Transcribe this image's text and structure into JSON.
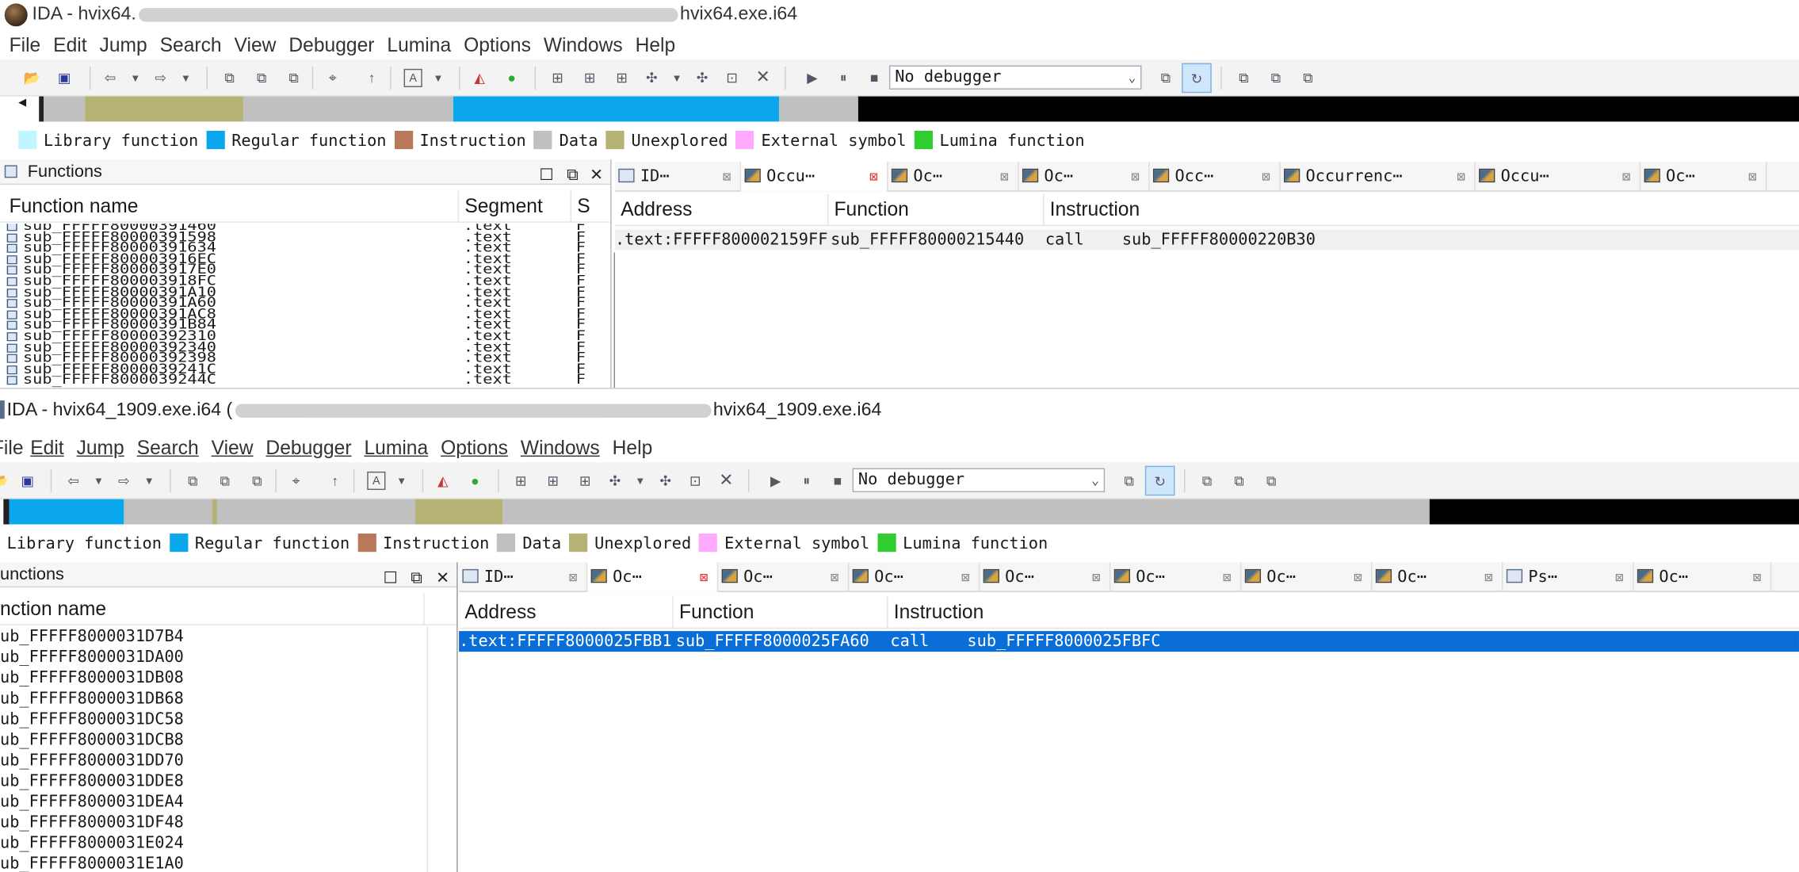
{
  "colors": {
    "library": "#bff6ff",
    "regular": "#0aa7ec",
    "instruction": "#b8785a",
    "data": "#c0c0c0",
    "unexplored": "#b5b274",
    "external": "#ffaaff",
    "lumina": "#2fcd2f",
    "selection": "#0a6ed8"
  },
  "legend": [
    {
      "label": "Library function",
      "color": "#bff6ff"
    },
    {
      "label": "Regular function",
      "color": "#0aa7ec"
    },
    {
      "label": "Instruction",
      "color": "#b8785a"
    },
    {
      "label": "Data",
      "color": "#c0c0c0"
    },
    {
      "label": "Unexplored",
      "color": "#b5b274"
    },
    {
      "label": "External symbol",
      "color": "#ffaaff"
    },
    {
      "label": "Lumina function",
      "color": "#2fcd2f"
    }
  ],
  "menu": [
    "File",
    "Edit",
    "Jump",
    "Search",
    "View",
    "Debugger",
    "Lumina",
    "Options",
    "Windows",
    "Help"
  ],
  "window1": {
    "title_prefix": "IDA - hvix64.",
    "title_suffix": "hvix64.exe.i64",
    "debugger": "No debugger",
    "functions_title": "Functions",
    "col_function_name": "Function name",
    "col_segment": "Segment",
    "col_s": "S",
    "functions": [
      "sub_FFFFF80000391460",
      "sub_FFFFF80000391598",
      "sub_FFFFF80000391634",
      "sub_FFFFF800003916EC",
      "sub_FFFFF800003917E0",
      "sub_FFFFF800003918FC",
      "sub_FFFFF80000391A10",
      "sub_FFFFF80000391A60",
      "sub_FFFFF80000391AC8",
      "sub_FFFFF80000391B84",
      "sub_FFFFF80000392310",
      "sub_FFFFF80000392340",
      "sub_FFFFF80000392398",
      "sub_FFFFF8000039241C",
      "sub_FFFFF8000039244C"
    ],
    "segment": ".text",
    "segment_s": "F",
    "tabs": [
      "ID⋯",
      "Occu⋯",
      "Oc⋯",
      "Oc⋯",
      "Occ⋯",
      "Occurrenc⋯",
      "Occu⋯",
      "Oc⋯"
    ],
    "cols": {
      "address": "Address",
      "function": "Function",
      "instruction": "Instruction"
    },
    "row": {
      "address": ".text:FFFFF800002159FF",
      "function": "sub_FFFFF80000215440",
      "mnemonic": "call",
      "operand": "sub_FFFFF80000220B30"
    }
  },
  "window2": {
    "title_prefix": "IDA - hvix64_1909.exe.i64 (",
    "title_suffix": "hvix64_1909.exe.i64",
    "debugger": "No debugger",
    "functions_title": "unctions",
    "col_function_name": "nction name",
    "functions": [
      "ub_FFFFF8000031D7B4",
      "ub_FFFFF8000031DA00",
      "ub_FFFFF8000031DB08",
      "ub_FFFFF8000031DB68",
      "ub_FFFFF8000031DC58",
      "ub_FFFFF8000031DCB8",
      "ub_FFFFF8000031DD70",
      "ub_FFFFF8000031DDE8",
      "ub_FFFFF8000031DEA4",
      "ub_FFFFF8000031DF48",
      "ub_FFFFF8000031E024",
      "ub_FFFFF8000031E1A0"
    ],
    "tabs": [
      "ID⋯",
      "Oc⋯",
      "Oc⋯",
      "Oc⋯",
      "Oc⋯",
      "Oc⋯",
      "Oc⋯",
      "Oc⋯",
      "Ps⋯",
      "Oc⋯"
    ],
    "cols": {
      "address": "Address",
      "function": "Function",
      "instruction": "Instruction"
    },
    "row": {
      "address": ".text:FFFFF8000025FBB1",
      "function": "sub_FFFFF8000025FA60",
      "mnemonic": "call",
      "operand": "sub_FFFFF8000025FBFC"
    }
  }
}
